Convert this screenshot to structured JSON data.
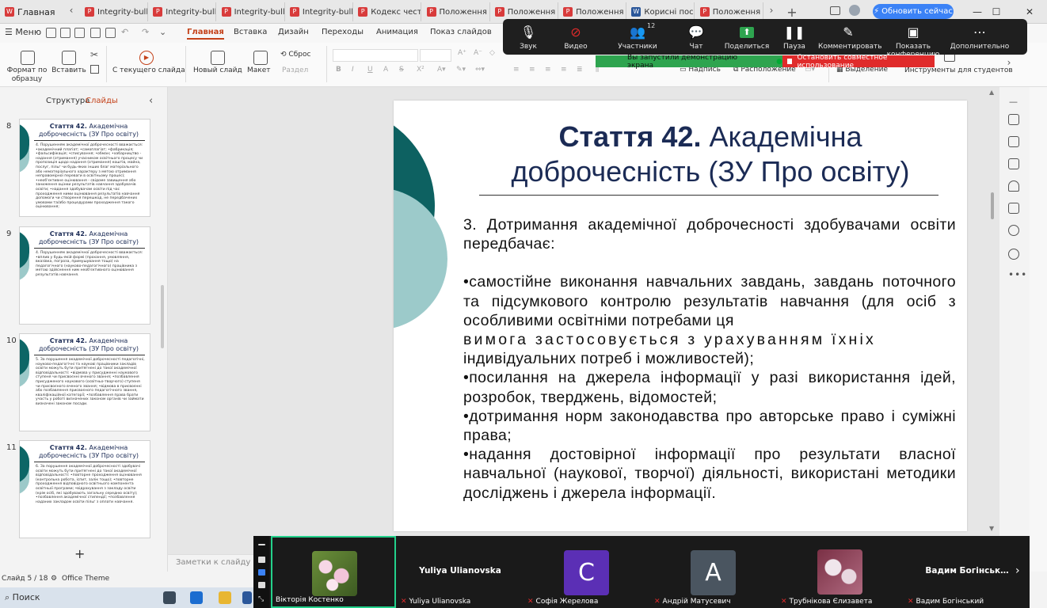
{
  "tabbar": {
    "home_label": "Главная",
    "tabs": [
      {
        "label": "Integrity-bulle",
        "icon": "pdf"
      },
      {
        "label": "Integrity-bulle",
        "icon": "pdf"
      },
      {
        "label": "Integrity-bulle",
        "icon": "pdf"
      },
      {
        "label": "Integrity-bulle",
        "icon": "pdf"
      },
      {
        "label": "Кодекс честі т",
        "icon": "pdf"
      },
      {
        "label": "Положення п",
        "icon": "pdf"
      },
      {
        "label": "Положення п",
        "icon": "pdf"
      },
      {
        "label": "Положення п",
        "icon": "pdf"
      },
      {
        "label": "Корисні поси",
        "icon": "word"
      },
      {
        "label": "Положення У",
        "icon": "pdf"
      }
    ],
    "update_button": "Обновить сейчас"
  },
  "menubar": {
    "menu_label": "Меню",
    "tabs": [
      "Главная",
      "Вставка",
      "Дизайн",
      "Переходы",
      "Анимация",
      "Показ слайдов"
    ]
  },
  "ribbon": {
    "format_painter": "Формат по образцу",
    "paste": "Вставить",
    "from_current": "С текущего слайда",
    "new_slide": "Новый слайд",
    "layout": "Макет",
    "reset": "Сброс",
    "section": "Раздел",
    "textbox": "Надпись",
    "arrange": "Расположение",
    "select": "Выделение",
    "student_tools": "Инструменты для студентов"
  },
  "zoom": {
    "buttons": [
      {
        "label": "Звук",
        "icon": "microphone-icon"
      },
      {
        "label": "Видео",
        "icon": "video-off-icon"
      },
      {
        "label": "Участники",
        "icon": "participants-icon",
        "count": "12"
      },
      {
        "label": "Чат",
        "icon": "chat-icon"
      },
      {
        "label": "Поделиться",
        "icon": "share-screen-icon"
      },
      {
        "label": "Пауза",
        "icon": "pause-icon"
      },
      {
        "label": "Комментировать",
        "icon": "annotate-icon"
      },
      {
        "label": "Показать конференцию",
        "icon": "show-meeting-icon"
      },
      {
        "label": "Дополнительно",
        "icon": "more-icon"
      }
    ],
    "share_banner": "Вы запустили демонстрацию экрана",
    "stop_banner": "Остановить совместное использование"
  },
  "sidebar": {
    "tab_structure": "Структура",
    "tab_slides": "Слайды",
    "thumbnails": [
      {
        "number": "8",
        "title_bold": "Стаття 42.",
        "title_rest": " Академічна доброчесність (ЗУ Про освіту)",
        "body": "4. Порушенням академічної доброчесності вважається: •академічний плагіат; •самоплагіат; •фабрикація; •фальсифікація; •списування; •обман; •хабарництво - надання (отримання) учасником освітнього процесу чи пропозиція щодо надання (отримання) коштів, майна, послуг, пільг чи будь-яких інших благ матеріального або нематеріального характеру з метою отримання неправомірної переваги в освітньому процесі; •необ'єктивне оцінювання - свідоме завищення або заниження оцінки результатів навчання здобувачів освіти; •надання здобувачам освіти під час проходження ними оцінювання результатів навчання допомоги чи створення перешкод, не передбачених умовами та/або процедурами проходження такого оцінювання;"
      },
      {
        "number": "9",
        "title_bold": "Стаття 42.",
        "title_rest": " Академічна доброчесність (ЗУ Про освіту)",
        "body": "4. Порушенням академічної доброчесності вважається: •вплив у будь-якій формі (прохання, умовляння, вказівка, погроза, примушування тощо) на педагогічного (науково-педагогічного) працівника з метою здійснення ним необ'єктивного оцінювання результатів навчання."
      },
      {
        "number": "10",
        "title_bold": "Стаття 42.",
        "title_rest": " Академічна доброчесність (ЗУ Про освіту)",
        "body": "5. За порушення академічної доброчесності педагогічні, науково-педагогічні та наукові працівники закладів освіти можуть бути притягнені до такої академічної відповідальності: •відмова у присудженні наукового ступеня чи присвоєнні вченого звання; •позбавлення присудженого наукового (освітньо-творчого) ступеня чи присвоєного вченого звання; •відмова в присвоєнні або позбавлення присвоєного педагогічного звання, кваліфікаційної категорії; •позбавлення права брати участь у роботі визначених законом органів чи займати визначені законом посади."
      },
      {
        "number": "11",
        "title_bold": "Стаття 42.",
        "title_rest": " Академічна доброчесність (ЗУ Про освіту)",
        "body": "6. За порушення академічної доброчесності здобувачі освіти можуть бути притягнені до такої академічної відповідальності: •повторне проходження оцінювання (контрольна робота, іспит, залік тощо); •повторне проходження відповідного освітнього компонента освітньої програми; •відрахування з закладу освіти (крім осіб, які здобувають загальну середню освіту); •позбавлення академічної стипендії; •позбавлення наданих закладом освіти пільг з оплати навчання."
      }
    ]
  },
  "slide": {
    "title_bold": "Стаття 42.",
    "title_rest": " Академічна доброчесність (ЗУ Про освіту)",
    "intro": "3. Дотримання академічної доброчесності здобувачами освіти передбачає:",
    "bullet1a": "•самостійне виконання навчальних завдань, завдань поточного та підсумкового контролю результатів навчання (для осіб з особливими освітніми потребами ця",
    "bullet1b": "вимога застосовується з урахуванням їхніх",
    "bullet1c": "індивідуальних потреб і можливостей);",
    "bullet2": "•посилання на джерела інформації у разі використання ідей, розробок, тверджень, відомостей;",
    "bullet3": "•дотримання норм законодавства про авторське право і суміжні права;",
    "bullet4": "•надання достовірної інформації про результати власної навчальної (наукової, творчої) діяльності, використані методики досліджень і джерела інформації."
  },
  "notes_placeholder": "Заметки к слайду",
  "status": {
    "slide_counter": "Слайд 5 / 18",
    "theme": "Office Theme"
  },
  "taskbar": {
    "search": "Поиск"
  },
  "gallery": {
    "participants": [
      {
        "name": "Вікторія Костенко",
        "type": "photo",
        "active": true
      },
      {
        "name": "Yuliya Ulianovska",
        "type": "name",
        "display": "Yuliya Ulianovska"
      },
      {
        "name": "Софія Жерелова",
        "type": "avatar",
        "initial": "С",
        "color": "#5b2fb5"
      },
      {
        "name": "Андрій Матусевич",
        "type": "avatar",
        "initial": "А",
        "color": "#4a5560"
      },
      {
        "name": "Трубнікова Єлизавета",
        "type": "photo2"
      },
      {
        "name": "Вадим Богінський",
        "type": "name",
        "display": "Вадим Богінськ…"
      }
    ]
  },
  "colors": {
    "accent": "#c4421a",
    "slide_title": "#1b2b55",
    "teal_dark": "#0d6161",
    "teal_light": "#9ccaca",
    "zoom_share_green": "#2ea44f",
    "zoom_stop_red": "#e02b2b"
  }
}
